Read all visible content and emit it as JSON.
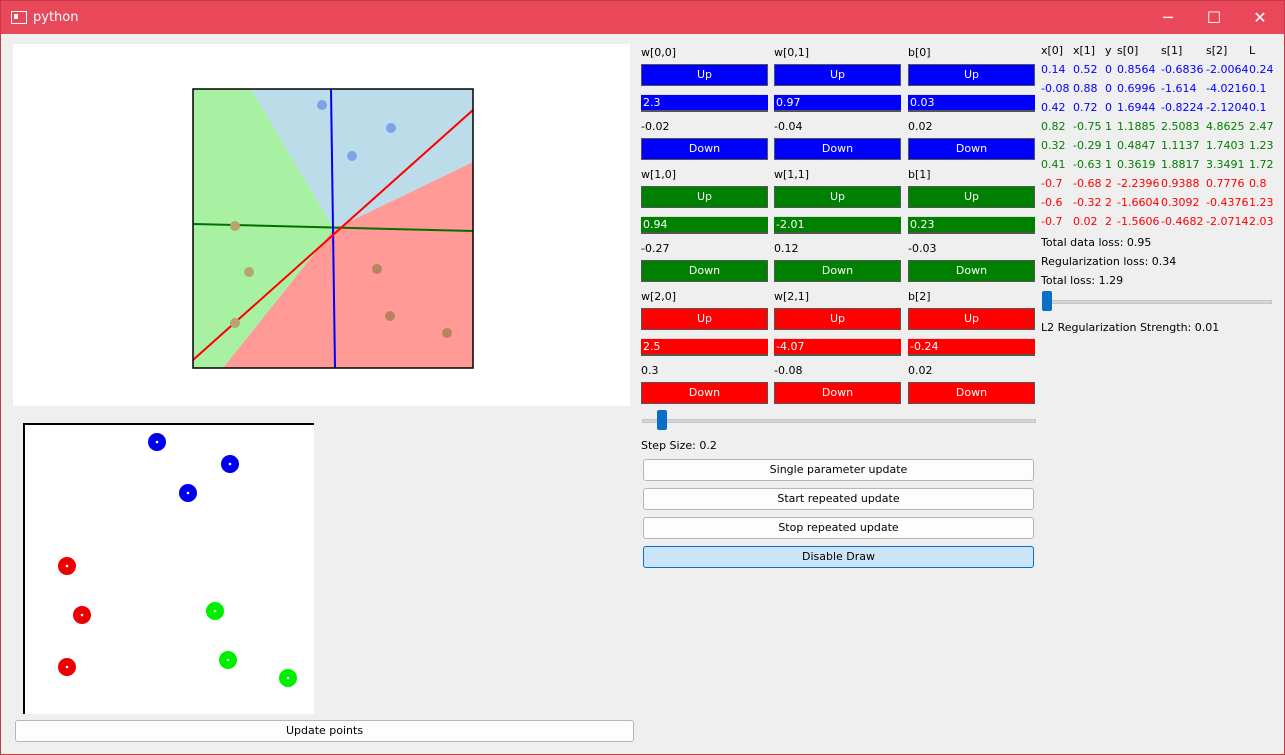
{
  "window": {
    "title": "python",
    "minimize": "─",
    "maximize": "☐",
    "close": "✕"
  },
  "update_points": "Update points",
  "params": [
    {
      "color": "#0000ff",
      "label": "w[0,0]",
      "up": "Up",
      "value": "2.3",
      "grad": "-0.02",
      "down": "Down"
    },
    {
      "color": "#0000ff",
      "label": "w[0,1]",
      "up": "Up",
      "value": "0.97",
      "grad": "-0.04",
      "down": "Down"
    },
    {
      "color": "#0000ff",
      "label": "b[0]",
      "up": "Up",
      "value": "0.03",
      "grad": "0.02",
      "down": "Down"
    },
    {
      "color": "#008000",
      "label": "w[1,0]",
      "up": "Up",
      "value": "0.94",
      "grad": "-0.27",
      "down": "Down"
    },
    {
      "color": "#008000",
      "label": "w[1,1]",
      "up": "Up",
      "value": "-2.01",
      "grad": "0.12",
      "down": "Down"
    },
    {
      "color": "#008000",
      "label": "b[1]",
      "up": "Up",
      "value": "0.23",
      "grad": "-0.03",
      "down": "Down"
    },
    {
      "color": "#ff0000",
      "label": "w[2,0]",
      "up": "Up",
      "value": "2.5",
      "grad": "0.3",
      "down": "Down"
    },
    {
      "color": "#ff0000",
      "label": "w[2,1]",
      "up": "Up",
      "value": "-4.07",
      "grad": "-0.08",
      "down": "Down"
    },
    {
      "color": "#ff0000",
      "label": "b[2]",
      "up": "Up",
      "value": "-0.24",
      "grad": "0.02",
      "down": "Down"
    }
  ],
  "step": {
    "label": "Step Size: 0.2",
    "value": 0.2
  },
  "actions": {
    "single": "Single parameter update",
    "start": "Start repeated update",
    "stop": "Stop repeated update",
    "draw": "Disable Draw"
  },
  "table": {
    "headers": [
      "x[0]",
      "x[1]",
      "y",
      "s[0]",
      "s[1]",
      "s[2]",
      "L"
    ],
    "rows": [
      {
        "color": "#0000ff",
        "cells": [
          "0.14",
          "0.52",
          "0",
          "0.8564",
          "-0.6836",
          "-2.0064",
          "0.24"
        ]
      },
      {
        "color": "#0000ff",
        "cells": [
          "-0.08",
          "0.88",
          "0",
          "0.6996",
          "-1.614",
          "-4.0216",
          "0.1"
        ]
      },
      {
        "color": "#0000ff",
        "cells": [
          "0.42",
          "0.72",
          "0",
          "1.6944",
          "-0.8224",
          "-2.1204",
          "0.1"
        ]
      },
      {
        "color": "#008000",
        "cells": [
          "0.82",
          "-0.75",
          "1",
          "1.1885",
          "2.5083",
          "4.8625",
          "2.47"
        ]
      },
      {
        "color": "#008000",
        "cells": [
          "0.32",
          "-0.29",
          "1",
          "0.4847",
          "1.1137",
          "1.7403",
          "1.23"
        ]
      },
      {
        "color": "#008000",
        "cells": [
          "0.41",
          "-0.63",
          "1",
          "0.3619",
          "1.8817",
          "3.3491",
          "1.72"
        ]
      },
      {
        "color": "#ff0000",
        "cells": [
          "-0.7",
          "-0.68",
          "2",
          "-2.2396",
          "0.9388",
          "0.7776",
          "0.8"
        ]
      },
      {
        "color": "#ff0000",
        "cells": [
          "-0.6",
          "-0.32",
          "2",
          "-1.6604",
          "0.3092",
          "-0.4376",
          "1.23"
        ]
      },
      {
        "color": "#ff0000",
        "cells": [
          "-0.7",
          "0.02",
          "2",
          "-1.5606",
          "-0.4682",
          "-2.0714",
          "2.03"
        ]
      }
    ]
  },
  "loss": {
    "data": "Total data loss: 0.95",
    "reg": "Regularization loss: 0.34",
    "total": "Total loss: 1.29"
  },
  "reg_strength": {
    "label": "L2 Regularization Strength: 0.01",
    "value": 0.01
  },
  "colors": {
    "titlebar": "#e8485a",
    "blue_region": "#bcdcea",
    "green_region": "#a8f0a2",
    "red_region": "#ff9a96",
    "accent": "#0a6fc6"
  }
}
